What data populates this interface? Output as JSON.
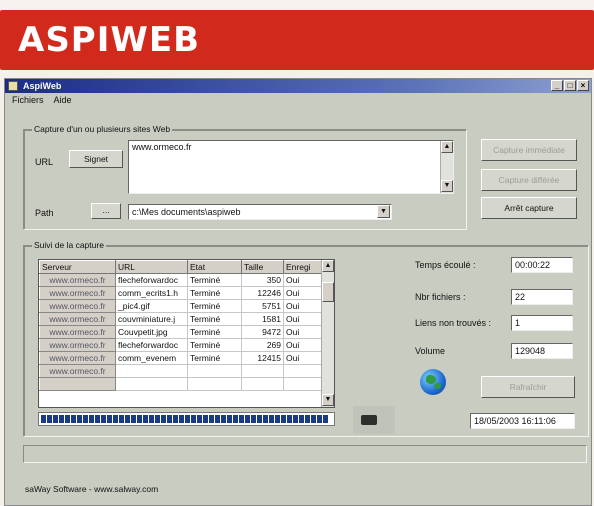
{
  "banner": {
    "title": "ASPIWEB"
  },
  "window": {
    "title": "AspiWeb",
    "controls": [
      "_",
      "□",
      "×"
    ]
  },
  "menu": [
    "Fichiers",
    "Aide"
  ],
  "capture": {
    "legend": "Capture d'un ou plusieurs sites Web",
    "url_label": "URL",
    "signet_label": "Signet",
    "url_value": "www.ormeco.fr",
    "path_label": "Path",
    "browse_label": "...",
    "path_value": "c:\\Mes documents\\aspiweb",
    "btn_immediate": "Capture immédiate",
    "btn_planned": "Capture différée",
    "btn_stop": "Arrêt capture"
  },
  "suivi": {
    "legend": "Suivi de la capture",
    "columns": [
      "Serveur",
      "URL",
      "Etat",
      "Taille",
      "Enregi"
    ],
    "rows": [
      {
        "serveur": "www.ormeco.fr",
        "url": "flecheforwardoc",
        "etat": "Terminé",
        "taille": "350",
        "enreg": "Oui"
      },
      {
        "serveur": "www.ormeco.fr",
        "url": "comm_ecrits1.h",
        "etat": "Terminé",
        "taille": "12246",
        "enreg": "Oui"
      },
      {
        "serveur": "www.ormeco.fr",
        "url": "_pic4.gif",
        "etat": "Terminé",
        "taille": "5751",
        "enreg": "Oui"
      },
      {
        "serveur": "www.ormeco.fr",
        "url": "couvminiature.j",
        "etat": "Terminé",
        "taille": "1581",
        "enreg": "Oui"
      },
      {
        "serveur": "www.ormeco.fr",
        "url": "Couvpetit.jpg",
        "etat": "Terminé",
        "taille": "9472",
        "enreg": "Oui"
      },
      {
        "serveur": "www.ormeco.fr",
        "url": "flecheforwardoc",
        "etat": "Terminé",
        "taille": "269",
        "enreg": "Oui"
      },
      {
        "serveur": "www.ormeco.fr",
        "url": "comm_evenem",
        "etat": "Terminé",
        "taille": "12415",
        "enreg": "Oui"
      },
      {
        "serveur": "www.ormeco.fr",
        "url": "",
        "etat": "",
        "taille": "",
        "enreg": ""
      },
      {
        "serveur": "",
        "url": "",
        "etat": "",
        "taille": "",
        "enreg": ""
      }
    ],
    "temps_label": "Temps écoulé :",
    "temps_value": "00:00:22",
    "fichiers_label": "Nbr fichiers :",
    "fichiers_value": "22",
    "liens_label": "Liens non trouvés :",
    "liens_value": "1",
    "volume_label": "Volume",
    "volume_value": "129048",
    "btn_refresh": "Rafraîchir",
    "datetime": "18/05/2003 16:11:06",
    "progress": 1.0
  },
  "footer": "saWay Software - www.salway.com"
}
